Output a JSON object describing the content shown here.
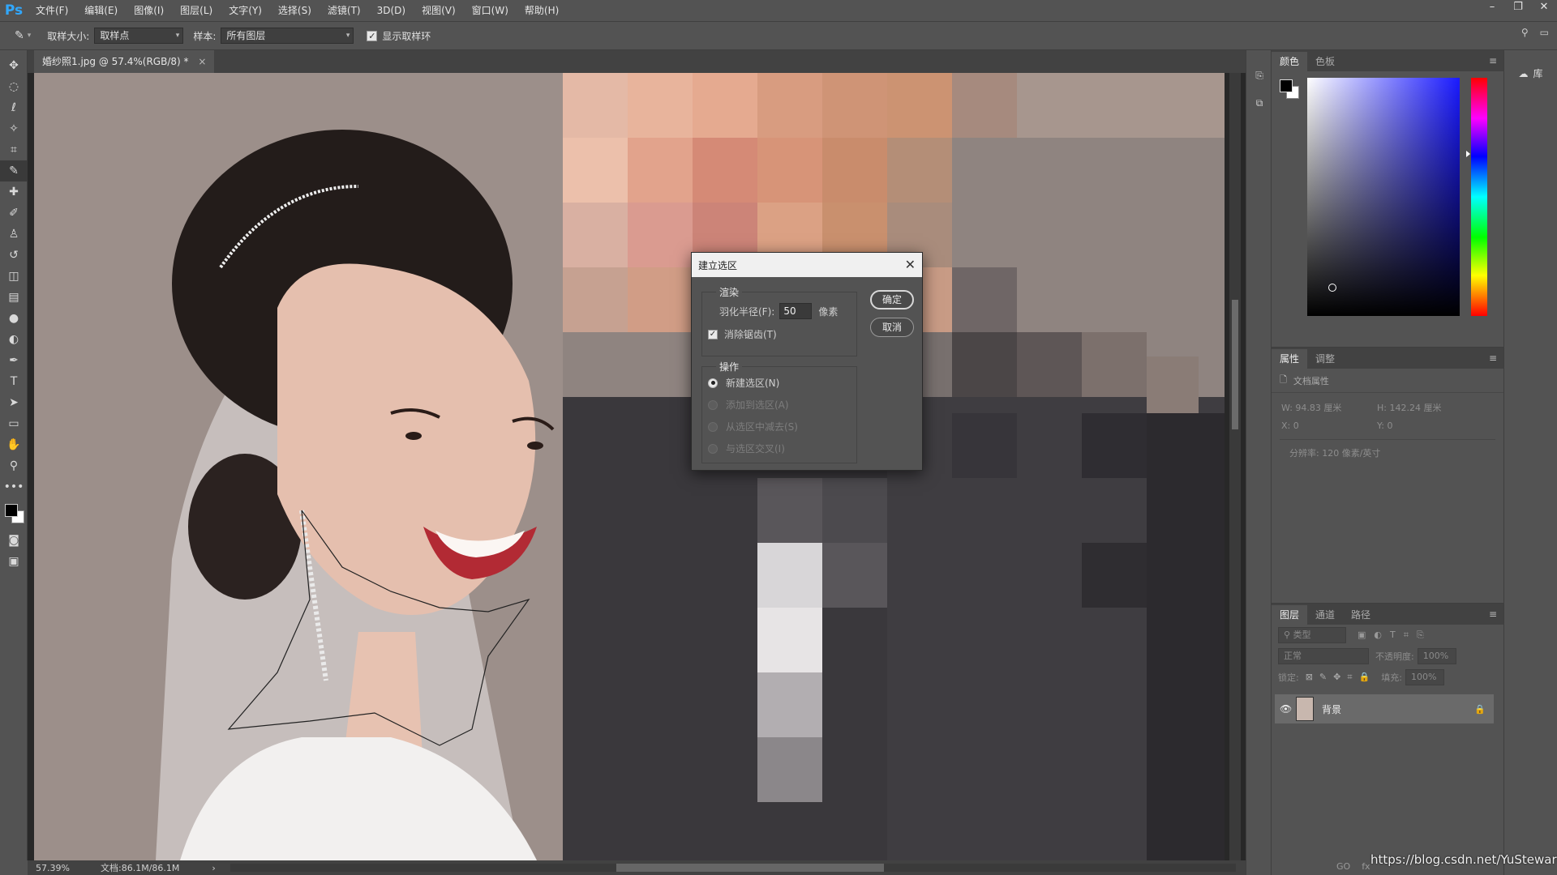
{
  "app": {
    "logo": "Ps"
  },
  "menu": [
    "文件(F)",
    "编辑(E)",
    "图像(I)",
    "图层(L)",
    "文字(Y)",
    "选择(S)",
    "滤镜(T)",
    "3D(D)",
    "视图(V)",
    "窗口(W)",
    "帮助(H)"
  ],
  "window_controls": {
    "minimize": "–",
    "restore": "❐",
    "close": "✕"
  },
  "options": {
    "sample_size_label": "取样大小:",
    "sample_size_value": "取样点",
    "sample_label": "样本:",
    "sample_value": "所有图层",
    "show_ring_label": "显示取样环"
  },
  "document": {
    "tab_title": "婚纱照1.jpg @ 57.4%(RGB/8) *",
    "close": "×"
  },
  "status": {
    "zoom": "57.39%",
    "doc_size": "文档:86.1M/86.1M",
    "arrow": "›"
  },
  "color_panel": {
    "tabs": [
      "颜色",
      "色板"
    ]
  },
  "properties_panel": {
    "tabs": [
      "属性",
      "调整"
    ],
    "doc_props": "文档属性",
    "w": "W:  94.83 厘米",
    "h": "H:  142.24 厘米",
    "x": "X:  0",
    "y": "Y:  0",
    "resolution": "分辨率: 120 像素/英寸"
  },
  "layers_panel": {
    "tabs": [
      "图层",
      "通道",
      "路径"
    ],
    "kind": "类型",
    "blend_mode": "正常",
    "opacity_label": "不透明度:",
    "opacity_value": "100%",
    "lock_label": "锁定:",
    "fill_label": "填充:",
    "fill_value": "100%",
    "layer_name": "背景",
    "footer": [
      "GO",
      "fx"
    ]
  },
  "library": {
    "label": "库"
  },
  "dialog": {
    "title": "建立选区",
    "render_group": "渲染",
    "feather_label": "羽化半径(F):",
    "feather_value": "50",
    "feather_unit": "像素",
    "antialias_label": "消除锯齿(T)",
    "operation_group": "操作",
    "op_new": "新建选区(N)",
    "op_add": "添加到选区(A)",
    "op_subtract": "从选区中减去(S)",
    "op_intersect": "与选区交叉(I)",
    "ok": "确定",
    "cancel": "取消"
  },
  "watermark": "https://blog.csdn.net/YuStewart",
  "icons": [
    "eyedropper-icon",
    "move-icon",
    "marquee-icon",
    "lasso-icon",
    "magic-wand-icon",
    "crop-icon",
    "healing-icon",
    "brush-icon",
    "stamp-icon",
    "history-brush-icon",
    "eraser-icon",
    "gradient-icon",
    "blur-icon",
    "dodge-icon",
    "pen-icon",
    "type-icon",
    "path-select-icon",
    "rectangle-icon",
    "hand-icon",
    "zoom-icon",
    "more-icon",
    "quick-mask-icon",
    "screen-mode-icon",
    "search-icon",
    "workspace-icon",
    "eye-icon",
    "lock-icon",
    "close-icon"
  ]
}
